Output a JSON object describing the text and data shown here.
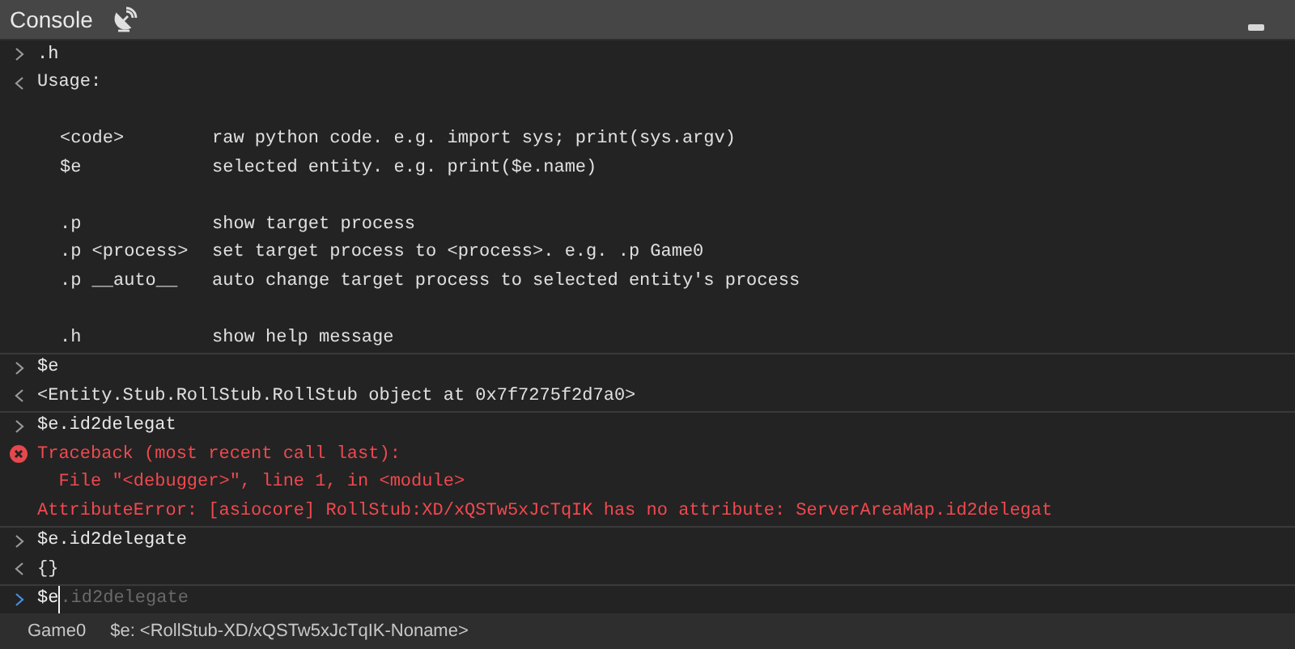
{
  "panel": {
    "title": "Console"
  },
  "entries": [
    {
      "kind": "input",
      "text": ".h"
    },
    {
      "kind": "help",
      "title": "Usage:",
      "groups": [
        [
          {
            "command": "<code>",
            "description": "raw python code. e.g. import sys; print(sys.argv)"
          },
          {
            "command": "$e",
            "description": "selected entity. e.g. print($e.name)"
          }
        ],
        [
          {
            "command": ".p",
            "description": "show target process"
          },
          {
            "command": ".p <process>",
            "description": "set target process to <process>. e.g. .p Game0"
          },
          {
            "command": ".p __auto__",
            "description": "auto change target process to selected entity's process"
          }
        ],
        [
          {
            "command": ".h",
            "description": "show help message"
          }
        ]
      ]
    },
    {
      "kind": "input",
      "text": "$e"
    },
    {
      "kind": "output",
      "lines": [
        "<Entity.Stub.RollStub.RollStub object at 0x7f7275f2d7a0>"
      ]
    },
    {
      "kind": "input",
      "text": "$e.id2delegat"
    },
    {
      "kind": "error",
      "lines": [
        "Traceback (most recent call last):",
        "  File \"<debugger>\", line 1, in <module>",
        "AttributeError: [asiocore] RollStub:XD/xQSTw5xJcTqIK has no attribute: ServerAreaMap.id2delegat"
      ]
    },
    {
      "kind": "input",
      "text": "$e.id2delegate"
    },
    {
      "kind": "output",
      "lines": [
        "{}"
      ]
    }
  ],
  "prompt": {
    "value": "$e",
    "suggestion": ".id2delegate"
  },
  "status_bar": {
    "process": "Game0",
    "selection": "$e: <RollStub-XD/xQSTw5xJcTqIK-Noname>"
  }
}
